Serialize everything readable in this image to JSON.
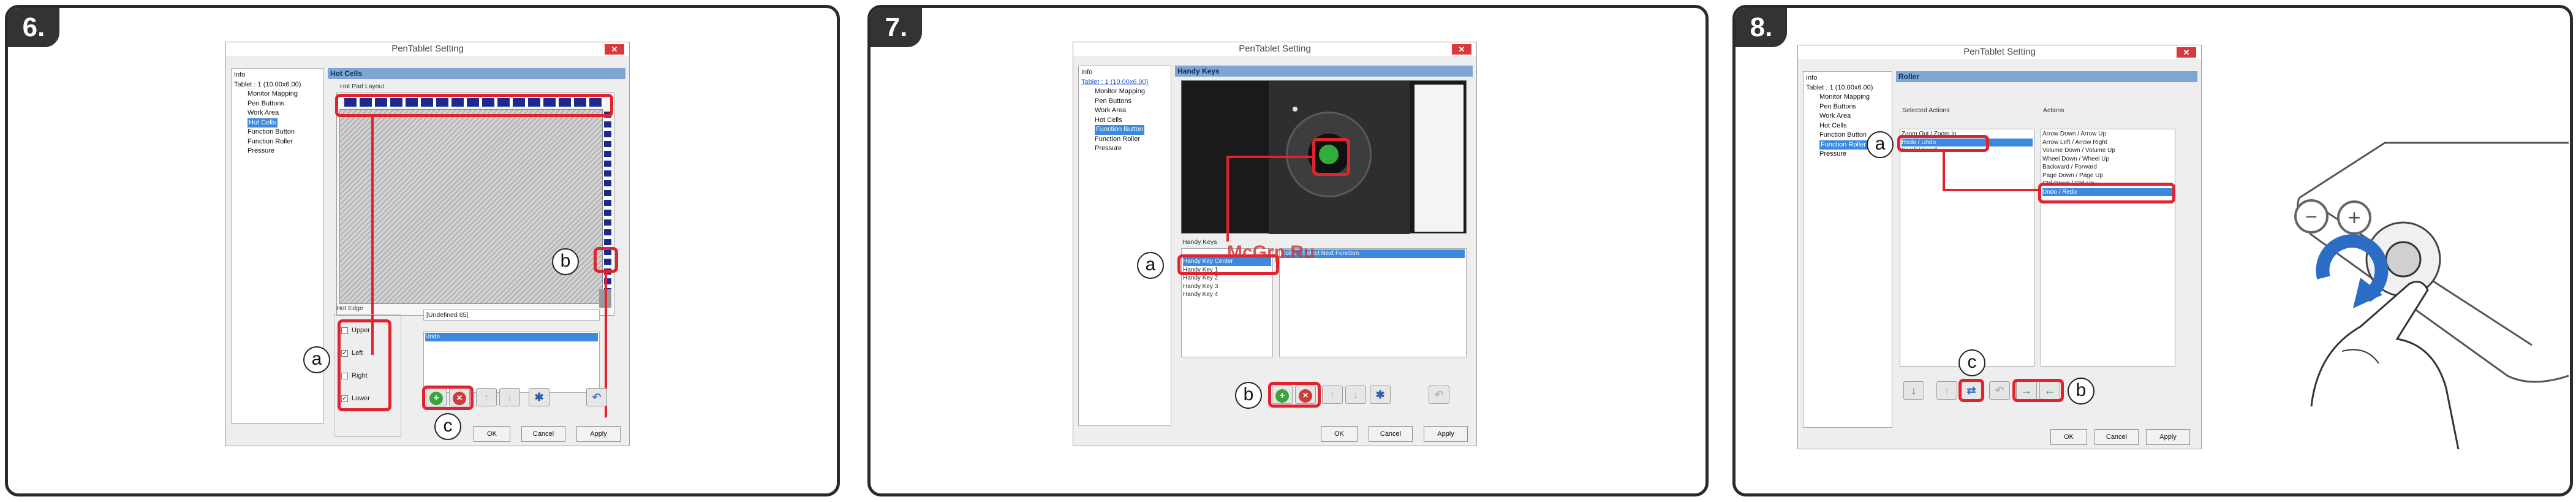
{
  "colors": {
    "highlight_red": "#e0232e",
    "selection_blue": "#3c8ae0",
    "header_blue": "#7fa6d3",
    "panel_border": "#2b2b2b"
  },
  "panels": [
    {
      "step": "6.",
      "window_title": "PenTablet Setting",
      "tree": {
        "root": "Info",
        "tablet": "Tablet : 1 (10.00x6.00)",
        "items": [
          "Monitor Mapping",
          "Pen Buttons",
          "Work Area",
          "Hot Cells",
          "Function Button",
          "Function Roller",
          "Pressure"
        ],
        "selected": "Hot Cells"
      },
      "section_header": "Hot Cells",
      "layout_label": "Hot Pad Layout",
      "hot_edge_label": "Hot Edge",
      "edges": [
        {
          "label": "Upper",
          "checked": false
        },
        {
          "label": "Left",
          "checked": true
        },
        {
          "label": "Right",
          "checked": false
        },
        {
          "label": "Lower",
          "checked": true
        }
      ],
      "dropdown_value": "[Undefined 65]",
      "actions_selected": "Undo",
      "buttons": {
        "ok": "OK",
        "cancel": "Cancel",
        "apply": "Apply"
      },
      "callouts": {
        "a": "a",
        "b": "b",
        "c": "c"
      }
    },
    {
      "step": "7.",
      "window_title": "PenTablet Setting",
      "tree": {
        "root": "Info",
        "tablet": "Tablet : 1 (10.00x6.00)",
        "items": [
          "Monitor Mapping",
          "Pen Buttons",
          "Work Area",
          "Hot Cells",
          "Function Button",
          "Function Roller",
          "Pressure"
        ],
        "selected": "Function Button"
      },
      "section_header": "Handy Keys",
      "handy_keys_label": "Handy Keys",
      "handy_keys": [
        "Handy Key Center",
        "Handy Key 1",
        "Handy Key 2",
        "Handy Key 3",
        "Handy Key 4"
      ],
      "handy_keys_selected": "Handy Key Center",
      "action_selected": "Roller - Select Next Function",
      "buttons": {
        "ok": "OK",
        "cancel": "Cancel",
        "apply": "Apply"
      },
      "callouts": {
        "a": "a",
        "b": "b"
      },
      "watermark": "McGrp.Ru"
    },
    {
      "step": "8.",
      "window_title": "PenTablet Setting",
      "tree": {
        "root": "Info",
        "tablet": "Tablet : 1 (10.00x6.00)",
        "items": [
          "Monitor Mapping",
          "Pen Buttons",
          "Work Area",
          "Hot Cells",
          "Function Button",
          "Function Roller",
          "Pressure"
        ],
        "selected": "Function Roller"
      },
      "section_header": "Roller",
      "selected_actions_label": "Selected Actions",
      "actions_label": "Actions",
      "selected_actions": [
        "Zoom Out / Zoom In",
        "Redo / Undo",
        "Scroll / Scroll"
      ],
      "selected_actions_selected": "Redo / Undo",
      "actions": [
        "Arrow Down / Arrow Up",
        "Arrow Left / Arrow Right",
        "Volume Down / Volume Up",
        "Wheel Down / Wheel Up",
        "Backward / Forward",
        "Page Down / Page Up",
        "Ctrl-Down / Ctrl-Up",
        "Undo / Redo"
      ],
      "actions_selected": "Undo / Redo",
      "buttons": {
        "ok": "OK",
        "cancel": "Cancel",
        "apply": "Apply"
      },
      "callouts": {
        "a": "a",
        "b": "b",
        "c": "c"
      },
      "illustration": {
        "minus": "−",
        "plus": "+"
      }
    }
  ]
}
